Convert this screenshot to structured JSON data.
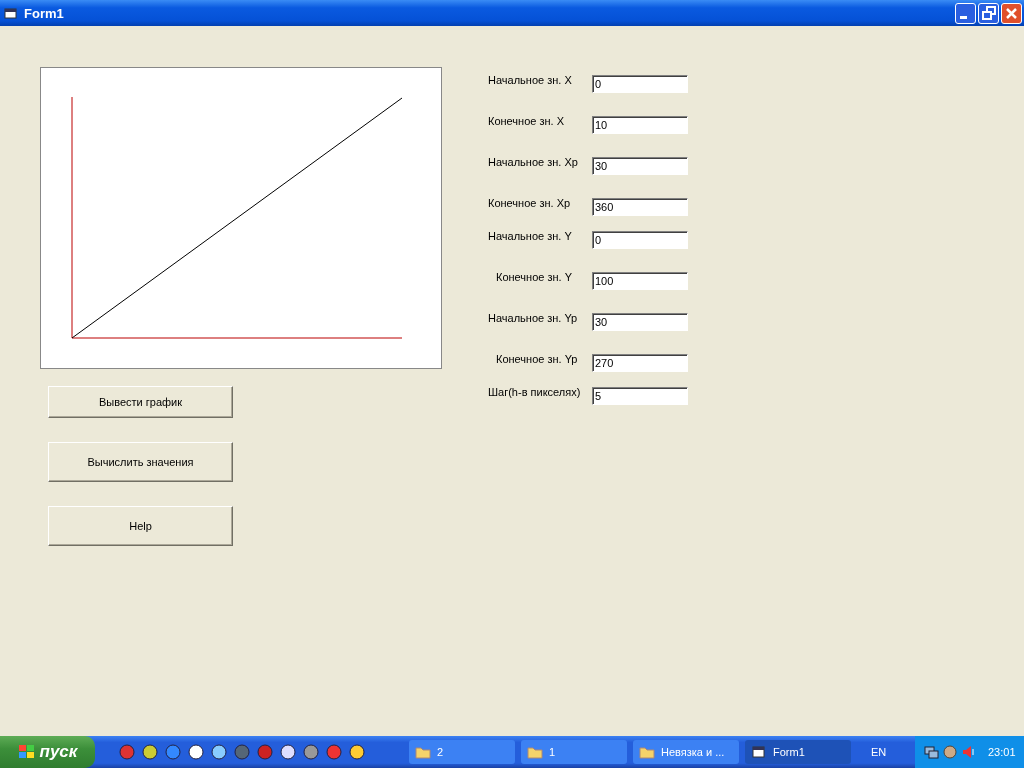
{
  "window": {
    "title": "Form1"
  },
  "fields": [
    {
      "label": "Начальное зн. X",
      "value": "0"
    },
    {
      "label": "Конечное зн. X",
      "value": "10"
    },
    {
      "label": "Начальное зн. Xp",
      "value": "30"
    },
    {
      "label": "Конечное зн. Xp",
      "value": "360"
    },
    {
      "label": "Начальное зн. Y",
      "value": "0"
    },
    {
      "label": "Конечное зн. Y",
      "value": "100"
    },
    {
      "label": "Начальное зн. Yp",
      "value": "30"
    },
    {
      "label": "Конечное зн. Yp",
      "value": "270"
    },
    {
      "label": "Шаг(h-в пикселях)",
      "value": "5"
    }
  ],
  "buttons": [
    "Вывести график",
    "Вычислить значения",
    "Help"
  ],
  "taskbar": {
    "start": "пуск",
    "tasks": [
      {
        "label": "2",
        "kind": "folder",
        "selected": false
      },
      {
        "label": "1",
        "kind": "folder",
        "selected": false
      },
      {
        "label": "Невязка и ...",
        "kind": "folder",
        "selected": false
      },
      {
        "label": "Form1",
        "kind": "window",
        "selected": true
      }
    ],
    "language": "EN",
    "clock": "23:01"
  }
}
